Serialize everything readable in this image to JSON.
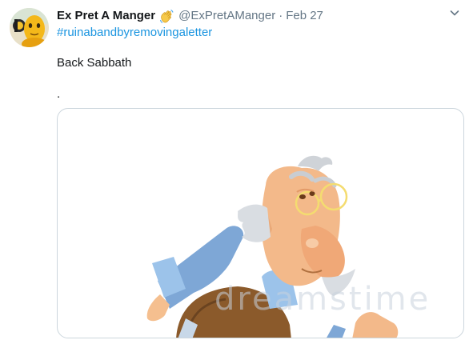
{
  "tweet": {
    "display_name": "Ex Pret A Manger",
    "handle": "@ExPretAManger",
    "separator": "·",
    "date": "Feb 27",
    "hashtag": "#ruinabandbyremovingaletter",
    "text_line1": "Back Sabbath",
    "text_line2": ".",
    "icons": {
      "badge": "waving-hand-icon",
      "more": "chevron-down-icon"
    },
    "media": {
      "watermark": "dreamstime"
    }
  },
  "colors": {
    "link": "#1b95e0",
    "secondary_text": "#657786",
    "border": "#ccd6dd"
  }
}
